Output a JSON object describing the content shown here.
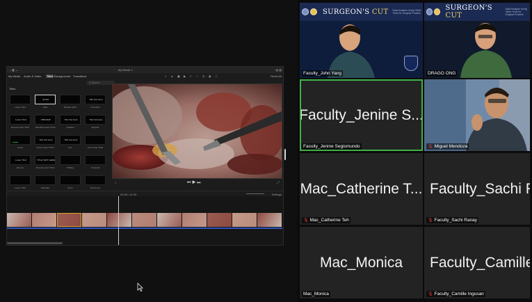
{
  "editor": {
    "window_title": "My Movie 1",
    "left_bar": "⌄ ◧ ⌄",
    "right_bar": "▤ ▥",
    "tabs": [
      {
        "label": "My Media"
      },
      {
        "label": "Audio & Video"
      },
      {
        "label": "Titles",
        "active": true
      },
      {
        "label": "Backgrounds"
      },
      {
        "label": "Transitions"
      }
    ],
    "tools": [
      "◐",
      "●",
      "▣",
      "▶",
      "≡",
      "◔",
      "⊘",
      "◉",
      "ⓘ"
    ],
    "reset_all": "Reset All",
    "search_placeholder": "Q  Search",
    "category_header": "Titles",
    "title_tiles": [
      {
        "text": "",
        "name": "Lower Third"
      },
      {
        "text": "ECHO",
        "name": "Split",
        "selected": true
      },
      {
        "text": "",
        "name": "Boogie Lights"
      },
      {
        "text": "Title Text Here",
        "name": "Formation"
      },
      {
        "text": "Lower Third",
        "name": "Reveal Lower Third"
      },
      {
        "text": "PREVIEW",
        "name": "Standard Lower Third"
      },
      {
        "text": "Title Text Here",
        "name": "Gradient"
      },
      {
        "text": "Title Text Here",
        "name": "Expand"
      },
      {
        "text": "",
        "name": "Focus"
      },
      {
        "text": "Title Text Here",
        "name": "Focus Lower Third"
      },
      {
        "text": "Title Text Here",
        "name": "Line"
      },
      {
        "text": "",
        "name": "Line Lower Third"
      },
      {
        "text": "Lower Third",
        "name": "Pop Up"
      },
      {
        "text": "TITLE TEXT HERE",
        "name": "Pop Up Lower Third"
      },
      {
        "text": "",
        "name": "Drifting"
      },
      {
        "text": "",
        "name": "Centered"
      },
      {
        "text": "",
        "name": "Lower Third"
      },
      {
        "text": "",
        "name": "Standard"
      },
      {
        "text": "",
        "name": "Prism"
      },
      {
        "text": "",
        "name": "Pull Focus"
      }
    ],
    "viewer_controls": {
      "prev": "⏮",
      "play": "▶",
      "next": "⏭",
      "volume": "♪",
      "fullscreen": "⤢"
    },
    "timecode": "00:48  /  11:03",
    "settings": "Settings",
    "clip_count": 11
  },
  "participants": [
    {
      "label": "Faculty_John Yang",
      "banner": true,
      "muted": false
    },
    {
      "label": "DRAGO ONG",
      "banner": true,
      "muted": false
    },
    {
      "label": "Faculty_Jenine Segismundo",
      "big_name": "Faculty_Jenine S...",
      "speaking": true,
      "muted": false
    },
    {
      "label": "Miguel Mendoza",
      "muted": true
    },
    {
      "label": "Mac_Catherine Teh",
      "big_name": "Mac_Catherine T...",
      "muted": true
    },
    {
      "label": "Faculty_Sachi Ranay",
      "big_name": "Faculty_Sachi R",
      "muted": true
    },
    {
      "label": "Mac_Monica",
      "big_name": "Mac_Monica",
      "muted": false
    },
    {
      "label": "Faculty_Camille Ingusan",
      "big_name": "Faculty_Camille",
      "muted": true
    }
  ],
  "banner": {
    "title_a": "SURGEON'S",
    "title_b": "CUT",
    "subtitle": "Data Analysis Using Video Tools for Surgical Practice"
  },
  "colors": {
    "speaking_border": "#3fb24a",
    "muted_icon": "#e23b3b",
    "timeline_audio": "#2e54b8",
    "banner_bg": "#1b2a52"
  }
}
